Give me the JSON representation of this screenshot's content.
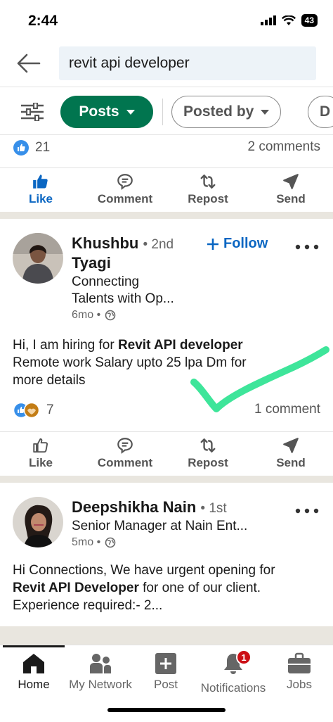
{
  "status": {
    "time": "2:44",
    "battery": "43"
  },
  "search": {
    "query": "revit api developer"
  },
  "filters": {
    "active": "Posts",
    "posted_by": "Posted by",
    "next_partial": "D"
  },
  "prev_post": {
    "reactions": "21",
    "comments": "2 comments"
  },
  "actions": {
    "like": "Like",
    "comment": "Comment",
    "repost": "Repost",
    "send": "Send"
  },
  "post1": {
    "name_first": "Khushbu",
    "name_last": "Tyagi",
    "degree": "• 2nd",
    "follow": "Follow",
    "headline_1": "Connecting",
    "headline_2": "Talents with Op...",
    "time": "6mo •",
    "text_pre": "Hi, I am hiring for ",
    "text_bold": "Revit API developer",
    "text_line2": "Remote work  Salary upto 25 lpa  Dm for",
    "text_line3": "more details",
    "reactions": "7",
    "comments": "1 comment"
  },
  "post2": {
    "name": "Deepshikha Nain",
    "degree": "• 1st",
    "headline": "Senior Manager at Nain Ent...",
    "time": "5mo •",
    "text_line1": "Hi Connections, We have urgent opening for",
    "text_bold": "Revit API Developer",
    "text_line2_rest": " for one of our client.",
    "text_line3": "Experience required:- 2..."
  },
  "nav": {
    "home": "Home",
    "network": "My Network",
    "post": "Post",
    "notifications": "Notifications",
    "notifications_badge": "1",
    "jobs": "Jobs"
  },
  "colors": {
    "brand_green": "#01754f",
    "link_blue": "#0a66c2",
    "badge_red": "#cc1016",
    "check_green": "#3ee59a"
  }
}
